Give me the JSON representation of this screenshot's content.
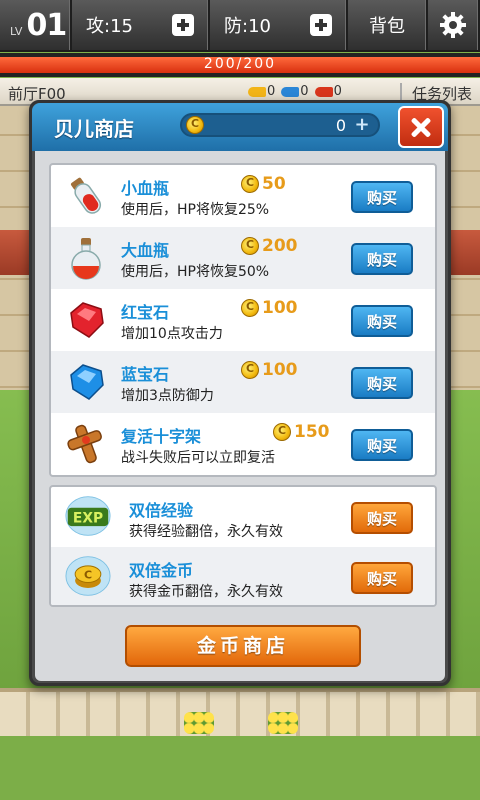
{
  "hud": {
    "lv_label": "LV",
    "lv_value": "01",
    "attack": "攻:15",
    "defense": "防:10",
    "bag": "背包"
  },
  "hp": {
    "text": "200/200",
    "current": 200,
    "max": 200
  },
  "info": {
    "floor": "前厅F00",
    "keys": [
      {
        "color": "#f2b418",
        "count": "0"
      },
      {
        "color": "#2b86d6",
        "count": "0"
      },
      {
        "color": "#d8351c",
        "count": "0"
      }
    ],
    "tasks": "任务列表"
  },
  "shop": {
    "title": "贝儿商店",
    "coins": "0",
    "coin_plus": "+",
    "buy_label": "购买",
    "items": [
      {
        "name": "小血瓶",
        "price": "50",
        "desc": "使用后，HP将恢复25%",
        "icon": "small-potion-icon"
      },
      {
        "name": "大血瓶",
        "price": "200",
        "desc": "使用后，HP将恢复50%",
        "icon": "large-potion-icon"
      },
      {
        "name": "红宝石",
        "price": "100",
        "desc": "增加10点攻击力",
        "icon": "ruby-icon"
      },
      {
        "name": "蓝宝石",
        "price": "100",
        "desc": "增加3点防御力",
        "icon": "sapphire-icon"
      },
      {
        "name": "复活十字架",
        "price": "150",
        "desc": "战斗失败后可以立即复活",
        "icon": "revive-cross-icon"
      }
    ],
    "specials": [
      {
        "name": "双倍经验",
        "desc": "获得经验翻倍，永久有效",
        "icon": "exp-badge-icon",
        "icon_text": "EXP"
      },
      {
        "name": "双倍金币",
        "desc": "获得金币翻倍，永久有效",
        "icon": "gold-coin-badge-icon"
      }
    ],
    "gold_shop": "金币商店"
  }
}
